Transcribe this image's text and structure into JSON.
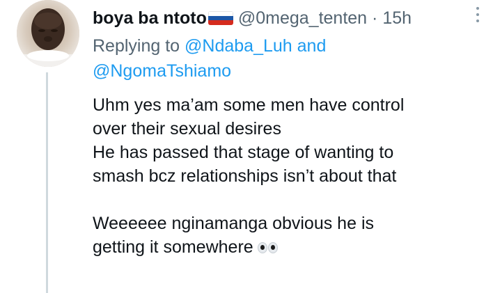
{
  "tweet": {
    "display_name": "boya ba ntoto",
    "flag_icon": "russia-flag-icon",
    "flag_colors": [
      "#ffffff",
      "#1c57a7",
      "#d52b1e"
    ],
    "handle": "@0mega_tenten",
    "separator": "·",
    "timestamp": "15h",
    "replying_prefix": "Replying to ",
    "mentions": [
      "@Ndaba_Luh",
      "@NgomaTshiamo"
    ],
    "mention_joiner": " and",
    "body_lines": [
      "Uhm yes ma’am some men have control",
      "over their sexual desires",
      "He has passed that stage of wanting to",
      "smash bcz relationships isn’t about that",
      "",
      "Weeeeee nginamanga obvious he is",
      "getting it somewhere"
    ],
    "trailing_emoji": "eyes-emoji",
    "colors": {
      "text": "#0f1419",
      "secondary": "#536471",
      "link": "#1d9bf0",
      "thread_line": "#cfd9de"
    }
  }
}
